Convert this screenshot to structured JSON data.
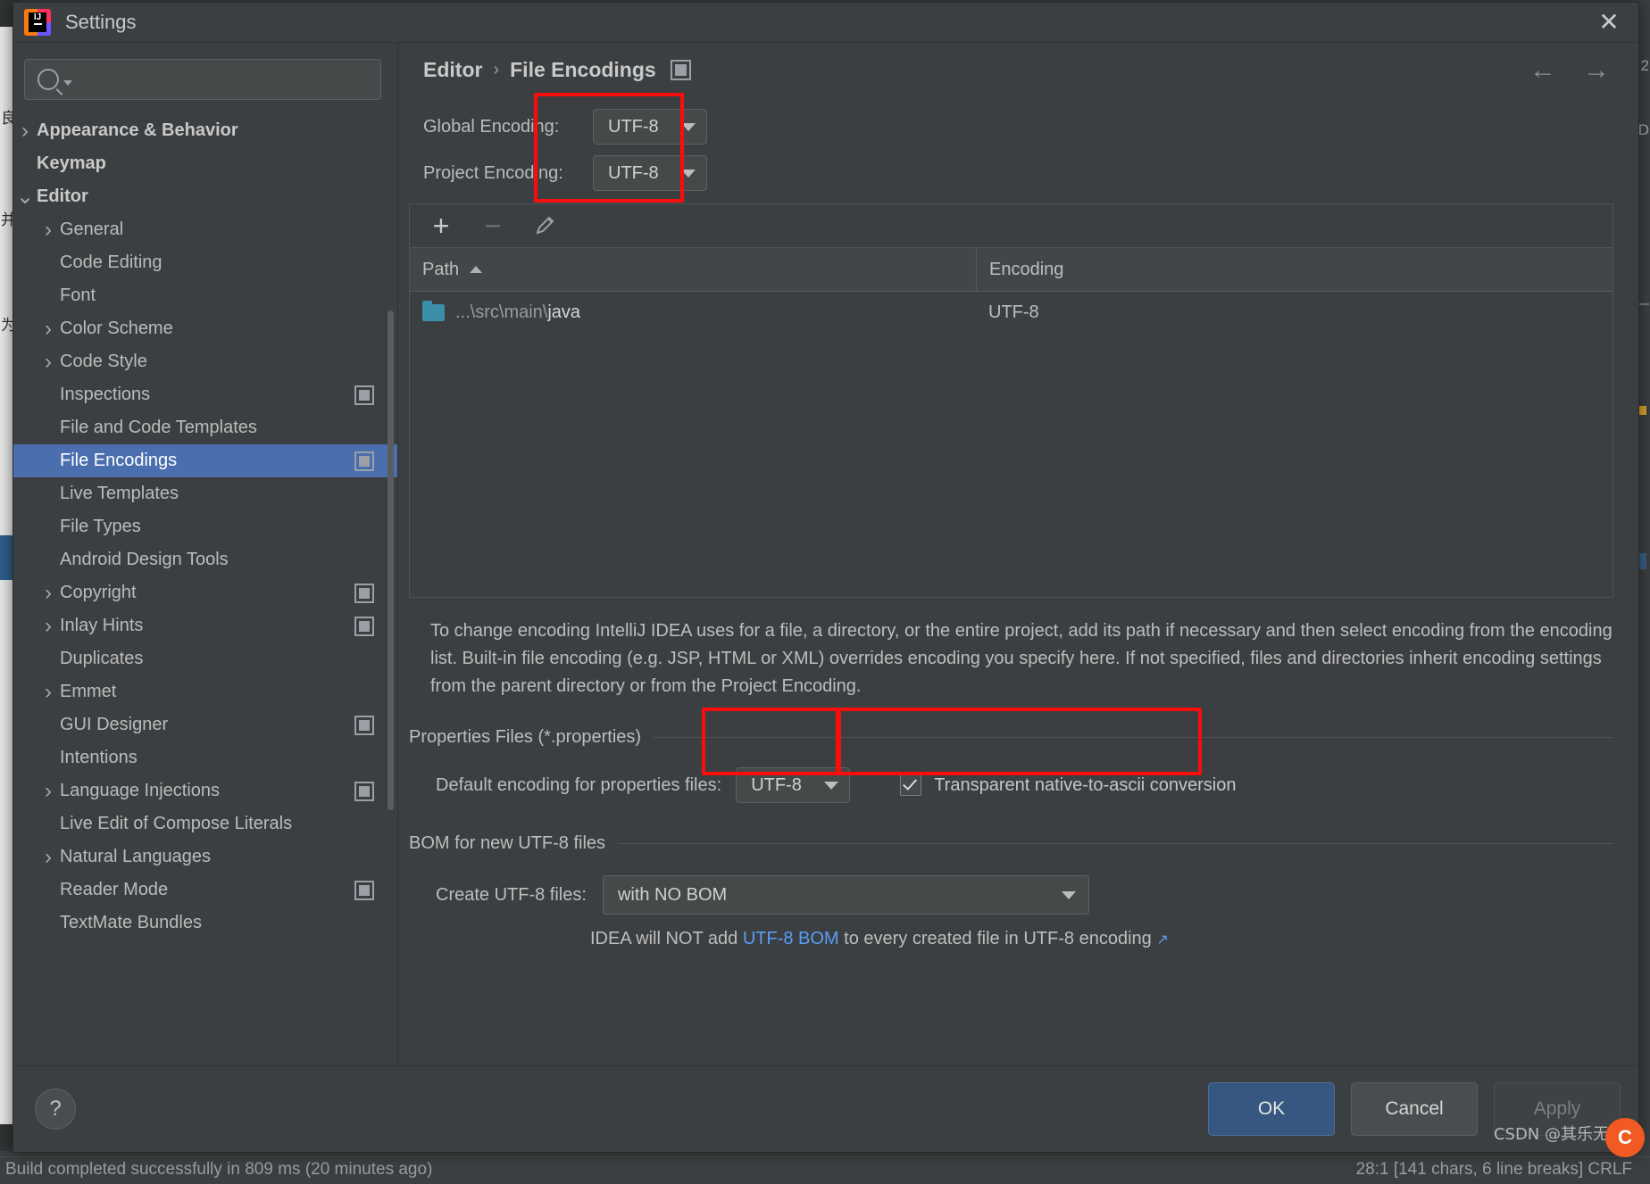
{
  "window": {
    "title": "Settings",
    "logo_icon": "intellij-idea-logo",
    "close_icon": "close-icon"
  },
  "search": {
    "value": "",
    "placeholder": "",
    "icon": "search-icon"
  },
  "sidebar": {
    "items": [
      {
        "label": "Appearance & Behavior",
        "chevron": "chevron-right-icon",
        "bold": true,
        "indent": 0,
        "selected": false,
        "config_icon": false
      },
      {
        "label": "Keymap",
        "chevron": "",
        "bold": true,
        "indent": 0,
        "selected": false,
        "config_icon": false
      },
      {
        "label": "Editor",
        "chevron": "chevron-down-icon",
        "bold": true,
        "indent": 0,
        "selected": false,
        "config_icon": false
      },
      {
        "label": "General",
        "chevron": "chevron-right-icon",
        "bold": false,
        "indent": 1,
        "selected": false,
        "config_icon": false
      },
      {
        "label": "Code Editing",
        "chevron": "",
        "bold": false,
        "indent": 1,
        "selected": false,
        "config_icon": false
      },
      {
        "label": "Font",
        "chevron": "",
        "bold": false,
        "indent": 1,
        "selected": false,
        "config_icon": false
      },
      {
        "label": "Color Scheme",
        "chevron": "chevron-right-icon",
        "bold": false,
        "indent": 1,
        "selected": false,
        "config_icon": false
      },
      {
        "label": "Code Style",
        "chevron": "chevron-right-icon",
        "bold": false,
        "indent": 1,
        "selected": false,
        "config_icon": false
      },
      {
        "label": "Inspections",
        "chevron": "",
        "bold": false,
        "indent": 1,
        "selected": false,
        "config_icon": true
      },
      {
        "label": "File and Code Templates",
        "chevron": "",
        "bold": false,
        "indent": 1,
        "selected": false,
        "config_icon": false
      },
      {
        "label": "File Encodings",
        "chevron": "",
        "bold": false,
        "indent": 1,
        "selected": true,
        "config_icon": true
      },
      {
        "label": "Live Templates",
        "chevron": "",
        "bold": false,
        "indent": 1,
        "selected": false,
        "config_icon": false
      },
      {
        "label": "File Types",
        "chevron": "",
        "bold": false,
        "indent": 1,
        "selected": false,
        "config_icon": false
      },
      {
        "label": "Android Design Tools",
        "chevron": "",
        "bold": false,
        "indent": 1,
        "selected": false,
        "config_icon": false
      },
      {
        "label": "Copyright",
        "chevron": "chevron-right-icon",
        "bold": false,
        "indent": 1,
        "selected": false,
        "config_icon": true
      },
      {
        "label": "Inlay Hints",
        "chevron": "chevron-right-icon",
        "bold": false,
        "indent": 1,
        "selected": false,
        "config_icon": true
      },
      {
        "label": "Duplicates",
        "chevron": "",
        "bold": false,
        "indent": 1,
        "selected": false,
        "config_icon": false
      },
      {
        "label": "Emmet",
        "chevron": "chevron-right-icon",
        "bold": false,
        "indent": 1,
        "selected": false,
        "config_icon": false
      },
      {
        "label": "GUI Designer",
        "chevron": "",
        "bold": false,
        "indent": 1,
        "selected": false,
        "config_icon": true
      },
      {
        "label": "Intentions",
        "chevron": "",
        "bold": false,
        "indent": 1,
        "selected": false,
        "config_icon": false
      },
      {
        "label": "Language Injections",
        "chevron": "chevron-right-icon",
        "bold": false,
        "indent": 1,
        "selected": false,
        "config_icon": true
      },
      {
        "label": "Live Edit of Compose Literals",
        "chevron": "",
        "bold": false,
        "indent": 1,
        "selected": false,
        "config_icon": false
      },
      {
        "label": "Natural Languages",
        "chevron": "chevron-right-icon",
        "bold": false,
        "indent": 1,
        "selected": false,
        "config_icon": false
      },
      {
        "label": "Reader Mode",
        "chevron": "",
        "bold": false,
        "indent": 1,
        "selected": false,
        "config_icon": true
      },
      {
        "label": "TextMate Bundles",
        "chevron": "",
        "bold": false,
        "indent": 1,
        "selected": false,
        "config_icon": false
      }
    ]
  },
  "breadcrumb": {
    "parent": "Editor",
    "separator": "›",
    "current": "File Encodings",
    "config_icon": "settings-config-icon"
  },
  "nav": {
    "back_icon": "←",
    "forward_icon": "→"
  },
  "encodings": {
    "global_label": "Global Encoding:",
    "global_value": "UTF-8",
    "project_label": "Project Encoding:",
    "project_value": "UTF-8"
  },
  "table": {
    "toolbar": {
      "add": "+",
      "remove": "−",
      "edit": "pencil-icon"
    },
    "columns": [
      "Path",
      "Encoding"
    ],
    "sort_column": "Path",
    "sort_direction": "ascending",
    "rows": [
      {
        "path_prefix": "...\\src\\main\\",
        "path_name": "java",
        "encoding": "UTF-8",
        "icon": "folder-icon"
      }
    ]
  },
  "description": "To change encoding IntelliJ IDEA uses for a file, a directory, or the entire project, add its path if necessary and then select encoding from the encoding list. Built-in file encoding (e.g. JSP, HTML or XML) overrides encoding you specify here. If not specified, files and directories inherit encoding settings from the parent directory or from the Project Encoding.",
  "properties_section": {
    "title": "Properties Files (*.properties)",
    "default_encoding_label": "Default encoding for properties files:",
    "default_encoding_value": "UTF-8",
    "transparent_checkbox_label": "Transparent native-to-ascii conversion",
    "transparent_checkbox_checked": true
  },
  "bom_section": {
    "title": "BOM for new UTF-8 files",
    "create_label": "Create UTF-8 files:",
    "create_value": "with NO BOM",
    "note_prefix": "IDEA will NOT add ",
    "note_link": "UTF-8 BOM",
    "note_suffix": " to every created file in UTF-8 encoding",
    "note_external_icon": "↗"
  },
  "footer": {
    "help_label": "?",
    "ok_label": "OK",
    "cancel_label": "Cancel",
    "apply_label": "Apply"
  },
  "ide_background": {
    "status_left": "Build completed successfully in 809 ms (20 minutes ago)",
    "status_right": "28:1  [141 chars, 6 line breaks]   CRLF",
    "left_gutter_chars": [
      "良",
      "并",
      "为"
    ],
    "right_edge_chars": [
      "2",
      "D",
      "—"
    ]
  },
  "watermark": {
    "text": "CSDN @其乐无穷",
    "logo": "C"
  },
  "colors": {
    "accent_selected": "#4b6eaf",
    "annotation_red": "#fb0d0d",
    "link_blue": "#589df6",
    "ok_button": "#365880",
    "folder": "#3d8fa8"
  }
}
